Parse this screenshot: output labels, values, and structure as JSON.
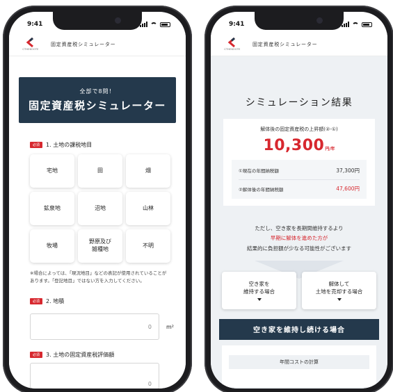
{
  "statusbar": {
    "time": "9:41"
  },
  "app": {
    "logo_text": "CTHEKOOTE",
    "header_title": "固定資産税シミュレーター",
    "brand_color": "#d7282f",
    "navy": "#24394c"
  },
  "input_screen": {
    "hero_sub": "全部で8問！",
    "hero_title": "固定資産税シミュレーター",
    "required_badge": "必須",
    "q1": {
      "label": "1. 土地の課税地目",
      "options": [
        "宅地",
        "田",
        "畑",
        "鉱泉地",
        "沼地",
        "山林",
        "牧場",
        "野原及び\n雑種地",
        "不明"
      ]
    },
    "note": "※場合によっては、「現況地目」などの表記が使用されていることがあります。「登記地目」ではない方を入力してください。",
    "q2": {
      "label": "2. 地積",
      "value": "0",
      "unit": "m²"
    },
    "q3": {
      "label": "3. 土地の固定資産税評価額",
      "value": "0"
    }
  },
  "result_screen": {
    "title": "シミュレーション結果",
    "increase_label": "解体後の固定資産税の上昇額(②-①)",
    "increase_value": "10,300",
    "increase_unit": "円/年",
    "rows": [
      {
        "label": "①現在の年間納税額",
        "value": "37,300円"
      },
      {
        "label": "②解体後の年間納税額",
        "value": "47,600円"
      }
    ],
    "advice_1": "ただし、空き家を長期間維持するより",
    "advice_2": "早期に解体を進めた方が",
    "advice_3": "結果的に負担額が少なる可能性がございます",
    "choice_a": "空き家を\n維持する場合",
    "choice_b": "解体して\n土地を売却する場合",
    "section_title": "空き家を維持し続ける場合",
    "cost_chip": "年間コストの計算"
  }
}
